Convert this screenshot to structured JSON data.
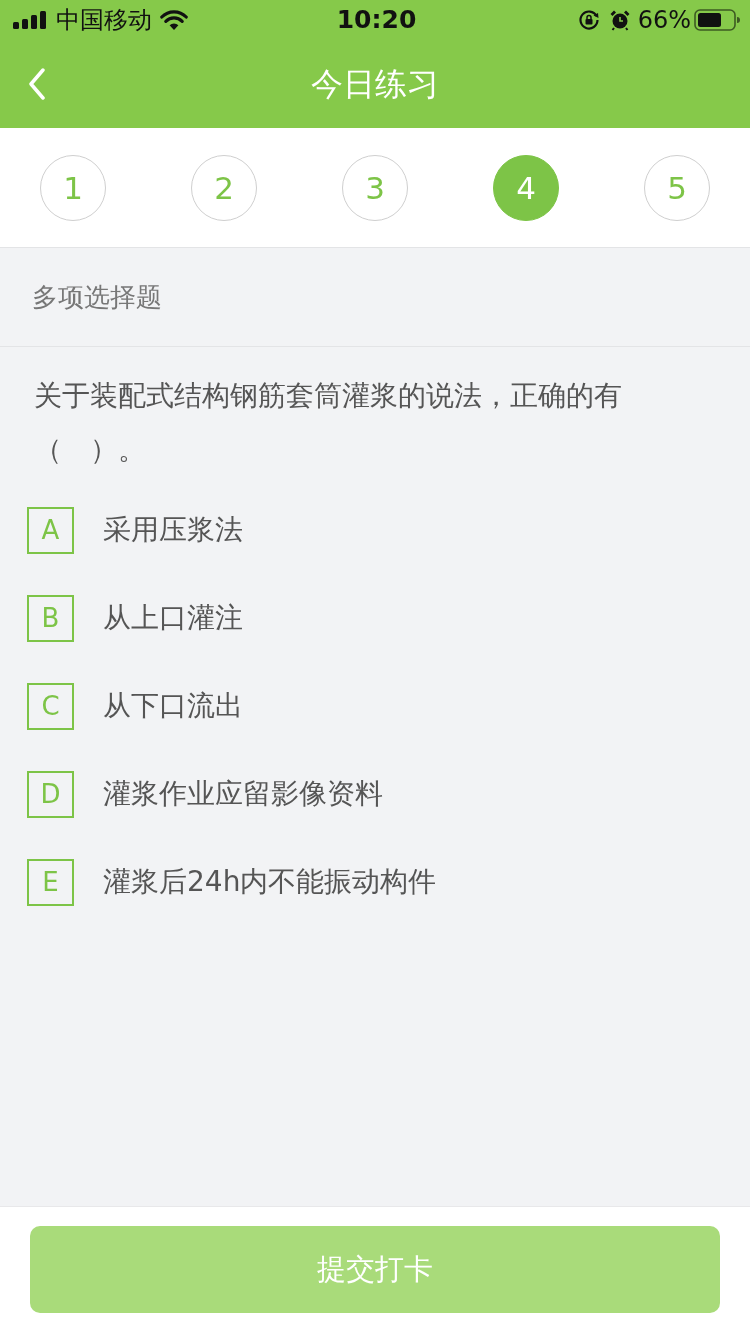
{
  "status_bar": {
    "carrier": "中国移动",
    "time": "10:20",
    "battery": "66%"
  },
  "nav": {
    "title": "今日练习"
  },
  "question_nav": [
    {
      "label": "1",
      "selected": false
    },
    {
      "label": "2",
      "selected": false
    },
    {
      "label": "3",
      "selected": false
    },
    {
      "label": "4",
      "selected": true
    },
    {
      "label": "5",
      "selected": false
    }
  ],
  "section": {
    "title": "多项选择题"
  },
  "question": {
    "text": "关于装配式结构钢筋套筒灌浆的说法，正确的有（　）。",
    "options": [
      {
        "letter": "A",
        "text": "采用压浆法",
        "selected": false
      },
      {
        "letter": "B",
        "text": "从上口灌注",
        "selected": false
      },
      {
        "letter": "C",
        "text": "从下口流出",
        "selected": false
      },
      {
        "letter": "D",
        "text": "灌浆作业应留影像资料",
        "selected": false
      },
      {
        "letter": "E",
        "text": "灌浆后24h内不能振动构件",
        "selected": false
      }
    ]
  },
  "footer": {
    "button": {
      "label": "提交打卡",
      "disabled": true
    }
  }
}
